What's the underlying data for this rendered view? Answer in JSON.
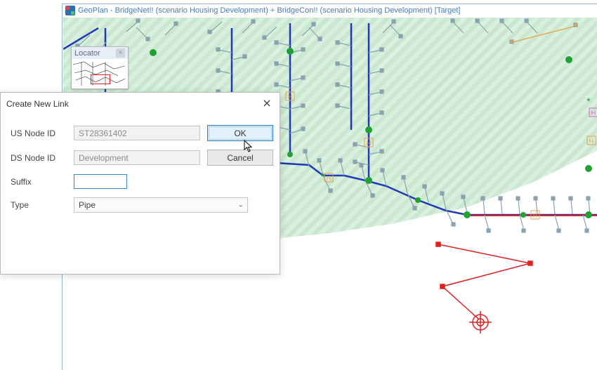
{
  "main_window": {
    "title": "GeoPlan - BridgeNet!! (scenario Housing Development)  + BridgeCon!! (scenario Housing Development)  [Target]"
  },
  "locator": {
    "title": "Locator"
  },
  "dialog": {
    "title": "Create New Link",
    "labels": {
      "us_node_id": "US Node ID",
      "ds_node_id": "DS Node ID",
      "suffix": "Suffix",
      "type": "Type"
    },
    "fields": {
      "us_node_id": "ST28361402",
      "ds_node_id": "Development",
      "suffix": "",
      "type_selected": "Pipe"
    },
    "buttons": {
      "ok": "OK",
      "cancel": "Cancel"
    }
  },
  "colors": {
    "accent": "#2a7bc9",
    "map_hatch_a": "#c9e8cf",
    "map_hatch_b": "#d8f0dd",
    "link_new": "#e02020",
    "pipe_main": "#2138b8",
    "pipe_secondary": "#8aa2b0"
  }
}
